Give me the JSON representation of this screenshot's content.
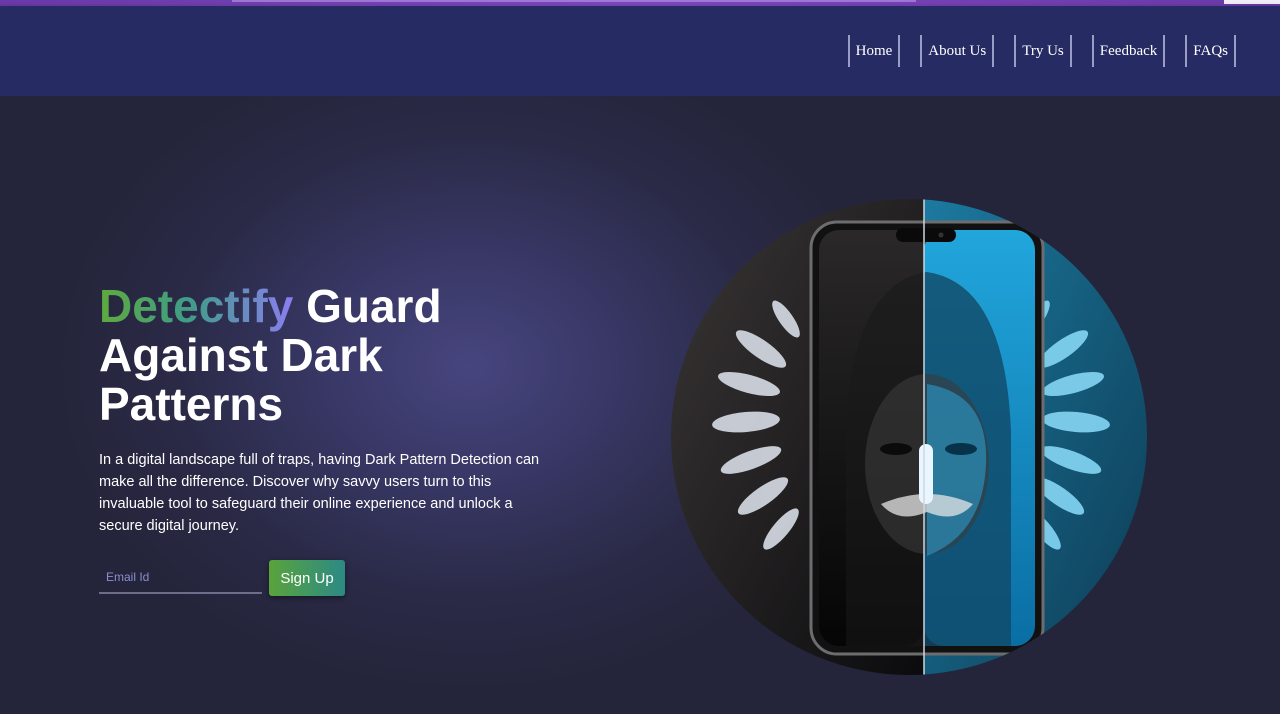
{
  "nav": {
    "items": [
      "Home",
      "About Us",
      "Try Us",
      "Feedback",
      "FAQs"
    ]
  },
  "hero": {
    "title_brand": "Detectify",
    "title_rest": " Guard Against Dark Patterns",
    "description": "In a digital landscape full of traps, having Dark Pattern Detection can make all the difference. Discover why savvy users turn to this invaluable tool to safeguard their online experience and unlock a secure digital journey.",
    "email_placeholder": "Email Id",
    "signup_label": "Sign Up"
  },
  "colors": {
    "header_bg": "#272b63",
    "hero_bg": "#2a2a47",
    "brand_gradient_start": "#5faa3d",
    "brand_gradient_end": "#8a7ef0",
    "button_gradient_start": "#5aa33c",
    "button_gradient_end": "#2b8a84"
  },
  "icons": {
    "hero_image": "masked-figure-phone-illustration"
  }
}
